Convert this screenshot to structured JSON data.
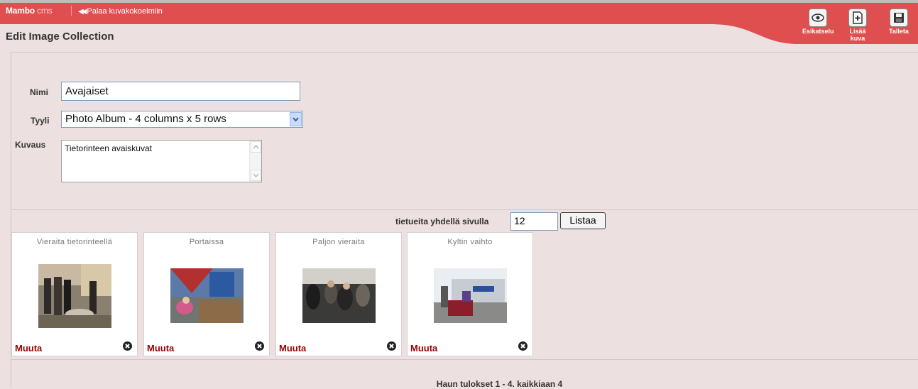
{
  "header": {
    "brand_main": "Mambo",
    "brand_cms": "cms",
    "back_link": "Palaa kuvakokoelmiin",
    "title": "Edit Image Collection",
    "colors": {
      "bar": "#e04f4f",
      "link": "#9b0000",
      "page_bg": "#ede0e0"
    }
  },
  "toolbar": {
    "preview_label": "Esikatselu",
    "add_image_label_1": "Lisää",
    "add_image_label_2": "kuva",
    "save_label": "Talleta",
    "preview_icon": "eye-icon",
    "add_icon": "add-image-icon",
    "save_icon": "floppy-icon"
  },
  "form": {
    "name_label": "Nimi",
    "name_value": "Avajaiset",
    "style_label": "Tyyli",
    "style_value": "Photo Album - 4 columns x 5 rows",
    "description_label": "Kuvaus",
    "description_value": "Tietorinteen avaiskuvat"
  },
  "paging": {
    "per_page_label": "tietueita yhdellä sivulla",
    "per_page_value": "12",
    "list_button": "Listaa"
  },
  "images": [
    {
      "title": "Vieraita tietorinteellä",
      "edit": "Muuta"
    },
    {
      "title": "Portaissa",
      "edit": "Muuta"
    },
    {
      "title": "Paljon vieraita",
      "edit": "Muuta"
    },
    {
      "title": "Kyltin vaihto",
      "edit": "Muuta"
    }
  ],
  "results_text": "Haun tulokset 1 - 4. kaikkiaan 4"
}
